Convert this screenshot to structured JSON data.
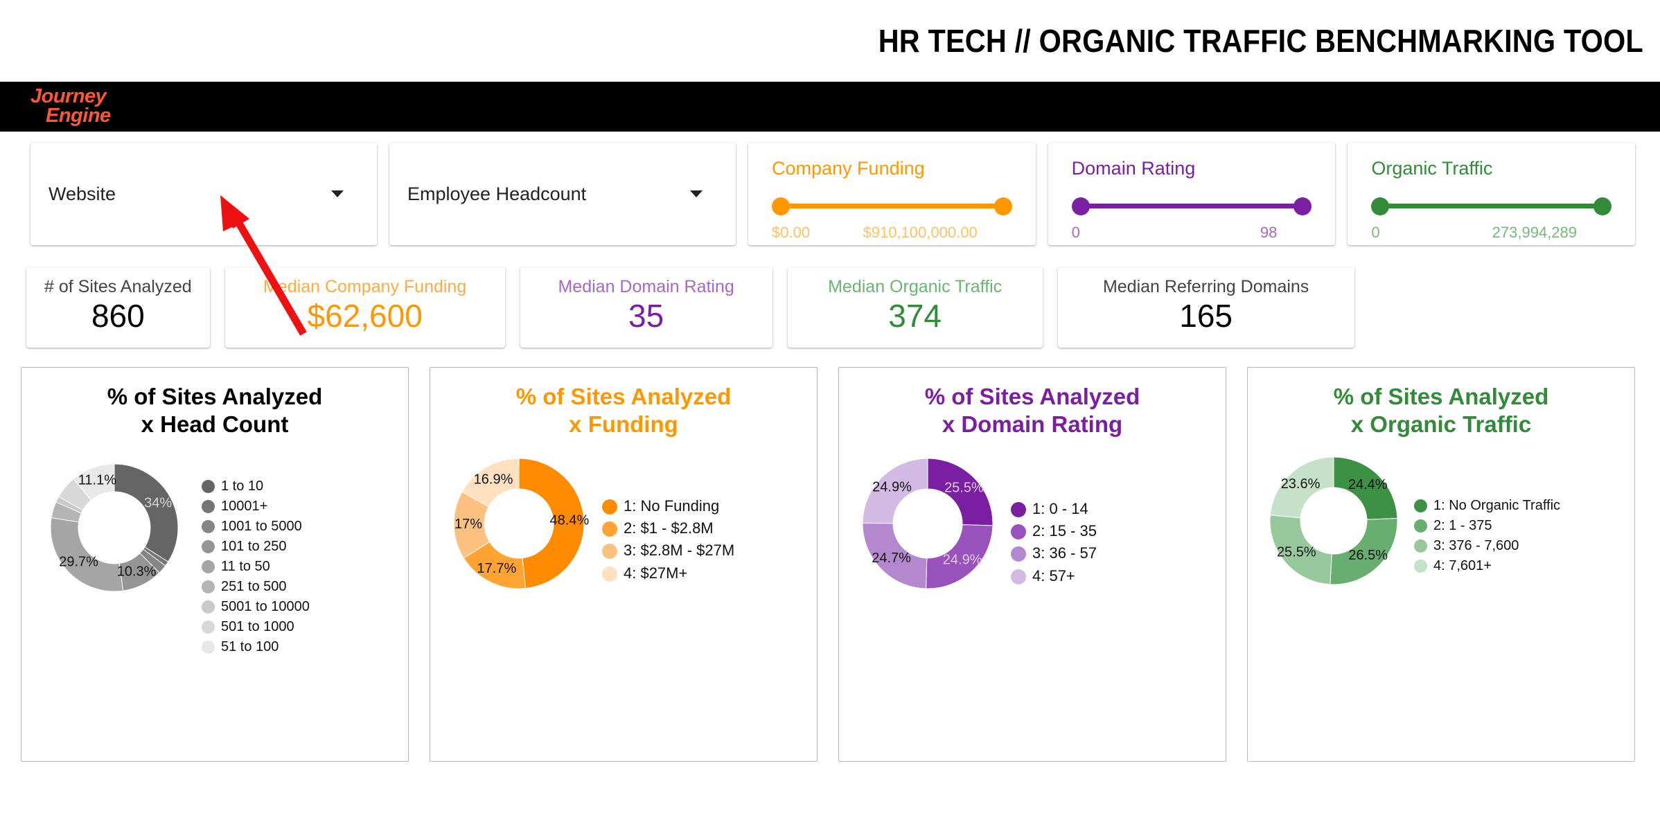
{
  "header": {
    "title": "HR TECH // ORGANIC TRAFFIC BENCHMARKING TOOL",
    "logo_line1": "Journey",
    "logo_line2": "Engine"
  },
  "colors": {
    "orange": "#FF9800",
    "orange_light": "#FFC166",
    "purple": "#7B1FA2",
    "purple_light": "#A768C4",
    "green": "#318B39",
    "green_light": "#76B97C",
    "black": "#000000",
    "logo": "#FF5733",
    "annotation": "#EE1111"
  },
  "filters": {
    "dropdowns": [
      {
        "name": "website",
        "label": "Website"
      },
      {
        "name": "employee-headcount",
        "label": "Employee Headcount"
      }
    ],
    "sliders": [
      {
        "name": "company-funding",
        "title": "Company Funding",
        "min_label": "$0.00",
        "max_label": "$910,100,000.00",
        "color": "#FF9800",
        "value_color": "#FFC166"
      },
      {
        "name": "domain-rating",
        "title": "Domain Rating",
        "min_label": "0",
        "max_label": "98",
        "color": "#7B1FA2",
        "value_color": "#A768C4"
      },
      {
        "name": "organic-traffic",
        "title": "Organic Traffic",
        "min_label": "0",
        "max_label": "273,994,289",
        "color": "#318B39",
        "value_color": "#76B97C"
      }
    ]
  },
  "kpis": [
    {
      "name": "sites-analyzed",
      "label": "# of Sites Analyzed",
      "value": "860",
      "label_color": "#444444",
      "value_color": "#000000"
    },
    {
      "name": "median-company-funding",
      "label": "Median Company Funding",
      "value": "$62,600",
      "label_color": "#FFAB40",
      "value_color": "#FF9800"
    },
    {
      "name": "median-domain-rating",
      "label": "Median Domain Rating",
      "value": "35",
      "label_color": "#A768C4",
      "value_color": "#7B1FA2"
    },
    {
      "name": "median-organic-traffic",
      "label": "Median Organic Traffic",
      "value": "374",
      "label_color": "#6BB472",
      "value_color": "#318B39"
    },
    {
      "name": "median-referring-domains",
      "label": "Median Referring Domains",
      "value": "165",
      "label_color": "#444444",
      "value_color": "#000000"
    }
  ],
  "chart_data": [
    {
      "type": "pie",
      "name": "head-count",
      "title": "% of Sites Analyzed\nx Head Count",
      "title_line1": "% of Sites Analyzed",
      "title_line2": "x Head Count",
      "title_color": "#000000",
      "legend_position": "right",
      "categories": [
        "1 to 10",
        "10001+",
        "1001 to 5000",
        "101 to 250",
        "11 to 50",
        "251 to 500",
        "5001 to 10000",
        "501 to 1000",
        "51 to 100"
      ],
      "values": [
        34,
        1.2,
        2.3,
        10.3,
        29.7,
        4.1,
        1.5,
        5.8,
        11.1
      ],
      "labels": [
        "34%",
        "",
        "",
        "10.3%",
        "29.7%",
        "",
        "",
        "",
        "11.1%"
      ],
      "colors": [
        "#656565",
        "#757575",
        "#858585",
        "#959595",
        "#A5A5A5",
        "#B4B4B4",
        "#C9C9C9",
        "#D8D8D8",
        "#E8E8E8"
      ]
    },
    {
      "type": "pie",
      "name": "funding",
      "title": "% of Sites Analyzed\nx Funding",
      "title_line1": "% of Sites Analyzed",
      "title_line2": "x Funding",
      "title_color": "#FF9800",
      "legend_position": "right",
      "categories": [
        "1: No Funding",
        "2: $1 - $2.8M",
        "3: $2.8M - $27M",
        "4: $27M+"
      ],
      "values": [
        48.4,
        17.7,
        17,
        16.9
      ],
      "labels": [
        "48.4%",
        "17.7%",
        "17%",
        "16.9%"
      ],
      "colors": [
        "#FF8C00",
        "#FFA333",
        "#FFC180",
        "#FFE0BF"
      ]
    },
    {
      "type": "pie",
      "name": "domain-rating",
      "title": "% of Sites Analyzed\nx Domain Rating",
      "title_line1": "% of Sites Analyzed",
      "title_line2": "x Domain Rating",
      "title_color": "#7B1FA2",
      "legend_position": "right",
      "categories": [
        "1: 0 - 14",
        "2: 15 - 35",
        "3: 36 - 57",
        "4: 57+"
      ],
      "values": [
        25.5,
        24.9,
        24.7,
        24.9
      ],
      "labels": [
        "25.5%",
        "24.9%",
        "24.7%",
        "24.9%"
      ],
      "colors": [
        "#7B1FA2",
        "#9951BB",
        "#B488CF",
        "#D2BAE4"
      ]
    },
    {
      "type": "pie",
      "name": "organic-traffic",
      "title": "% of Sites Analyzed\nx Organic Traffic",
      "title_line1": "% of Sites Analyzed",
      "title_line2": "x Organic Traffic",
      "title_color": "#318B39",
      "legend_position": "right",
      "categories": [
        "1: No Organic Traffic",
        "2: 1 - 375",
        "3: 376 - 7,600",
        "4: 7,601+"
      ],
      "values": [
        24.4,
        26.5,
        25.5,
        23.6
      ],
      "labels": [
        "24.4%",
        "26.5%",
        "25.5%",
        "23.6%"
      ],
      "colors": [
        "#3C9145",
        "#68AE70",
        "#97C89C",
        "#C5E1C7"
      ]
    }
  ],
  "annotation": {
    "name": "red-arrow",
    "points_to": "website"
  }
}
